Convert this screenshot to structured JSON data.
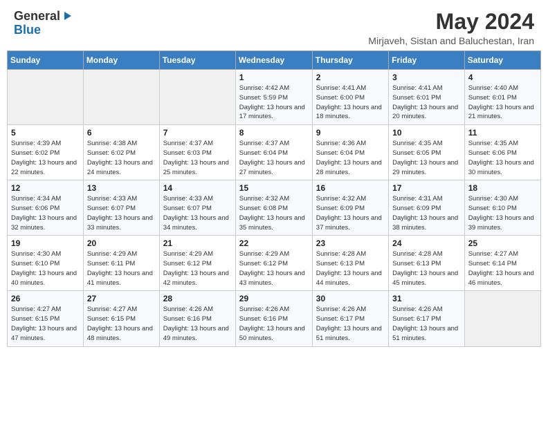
{
  "header": {
    "logo_general": "General",
    "logo_blue": "Blue",
    "month": "May 2024",
    "location": "Mirjaveh, Sistan and Baluchestan, Iran"
  },
  "weekdays": [
    "Sunday",
    "Monday",
    "Tuesday",
    "Wednesday",
    "Thursday",
    "Friday",
    "Saturday"
  ],
  "weeks": [
    [
      {
        "day": "",
        "sunrise": "",
        "sunset": "",
        "daylight": ""
      },
      {
        "day": "",
        "sunrise": "",
        "sunset": "",
        "daylight": ""
      },
      {
        "day": "",
        "sunrise": "",
        "sunset": "",
        "daylight": ""
      },
      {
        "day": "1",
        "sunrise": "Sunrise: 4:42 AM",
        "sunset": "Sunset: 5:59 PM",
        "daylight": "Daylight: 13 hours and 17 minutes."
      },
      {
        "day": "2",
        "sunrise": "Sunrise: 4:41 AM",
        "sunset": "Sunset: 6:00 PM",
        "daylight": "Daylight: 13 hours and 18 minutes."
      },
      {
        "day": "3",
        "sunrise": "Sunrise: 4:41 AM",
        "sunset": "Sunset: 6:01 PM",
        "daylight": "Daylight: 13 hours and 20 minutes."
      },
      {
        "day": "4",
        "sunrise": "Sunrise: 4:40 AM",
        "sunset": "Sunset: 6:01 PM",
        "daylight": "Daylight: 13 hours and 21 minutes."
      }
    ],
    [
      {
        "day": "5",
        "sunrise": "Sunrise: 4:39 AM",
        "sunset": "Sunset: 6:02 PM",
        "daylight": "Daylight: 13 hours and 22 minutes."
      },
      {
        "day": "6",
        "sunrise": "Sunrise: 4:38 AM",
        "sunset": "Sunset: 6:02 PM",
        "daylight": "Daylight: 13 hours and 24 minutes."
      },
      {
        "day": "7",
        "sunrise": "Sunrise: 4:37 AM",
        "sunset": "Sunset: 6:03 PM",
        "daylight": "Daylight: 13 hours and 25 minutes."
      },
      {
        "day": "8",
        "sunrise": "Sunrise: 4:37 AM",
        "sunset": "Sunset: 6:04 PM",
        "daylight": "Daylight: 13 hours and 27 minutes."
      },
      {
        "day": "9",
        "sunrise": "Sunrise: 4:36 AM",
        "sunset": "Sunset: 6:04 PM",
        "daylight": "Daylight: 13 hours and 28 minutes."
      },
      {
        "day": "10",
        "sunrise": "Sunrise: 4:35 AM",
        "sunset": "Sunset: 6:05 PM",
        "daylight": "Daylight: 13 hours and 29 minutes."
      },
      {
        "day": "11",
        "sunrise": "Sunrise: 4:35 AM",
        "sunset": "Sunset: 6:06 PM",
        "daylight": "Daylight: 13 hours and 30 minutes."
      }
    ],
    [
      {
        "day": "12",
        "sunrise": "Sunrise: 4:34 AM",
        "sunset": "Sunset: 6:06 PM",
        "daylight": "Daylight: 13 hours and 32 minutes."
      },
      {
        "day": "13",
        "sunrise": "Sunrise: 4:33 AM",
        "sunset": "Sunset: 6:07 PM",
        "daylight": "Daylight: 13 hours and 33 minutes."
      },
      {
        "day": "14",
        "sunrise": "Sunrise: 4:33 AM",
        "sunset": "Sunset: 6:07 PM",
        "daylight": "Daylight: 13 hours and 34 minutes."
      },
      {
        "day": "15",
        "sunrise": "Sunrise: 4:32 AM",
        "sunset": "Sunset: 6:08 PM",
        "daylight": "Daylight: 13 hours and 35 minutes."
      },
      {
        "day": "16",
        "sunrise": "Sunrise: 4:32 AM",
        "sunset": "Sunset: 6:09 PM",
        "daylight": "Daylight: 13 hours and 37 minutes."
      },
      {
        "day": "17",
        "sunrise": "Sunrise: 4:31 AM",
        "sunset": "Sunset: 6:09 PM",
        "daylight": "Daylight: 13 hours and 38 minutes."
      },
      {
        "day": "18",
        "sunrise": "Sunrise: 4:30 AM",
        "sunset": "Sunset: 6:10 PM",
        "daylight": "Daylight: 13 hours and 39 minutes."
      }
    ],
    [
      {
        "day": "19",
        "sunrise": "Sunrise: 4:30 AM",
        "sunset": "Sunset: 6:10 PM",
        "daylight": "Daylight: 13 hours and 40 minutes."
      },
      {
        "day": "20",
        "sunrise": "Sunrise: 4:29 AM",
        "sunset": "Sunset: 6:11 PM",
        "daylight": "Daylight: 13 hours and 41 minutes."
      },
      {
        "day": "21",
        "sunrise": "Sunrise: 4:29 AM",
        "sunset": "Sunset: 6:12 PM",
        "daylight": "Daylight: 13 hours and 42 minutes."
      },
      {
        "day": "22",
        "sunrise": "Sunrise: 4:29 AM",
        "sunset": "Sunset: 6:12 PM",
        "daylight": "Daylight: 13 hours and 43 minutes."
      },
      {
        "day": "23",
        "sunrise": "Sunrise: 4:28 AM",
        "sunset": "Sunset: 6:13 PM",
        "daylight": "Daylight: 13 hours and 44 minutes."
      },
      {
        "day": "24",
        "sunrise": "Sunrise: 4:28 AM",
        "sunset": "Sunset: 6:13 PM",
        "daylight": "Daylight: 13 hours and 45 minutes."
      },
      {
        "day": "25",
        "sunrise": "Sunrise: 4:27 AM",
        "sunset": "Sunset: 6:14 PM",
        "daylight": "Daylight: 13 hours and 46 minutes."
      }
    ],
    [
      {
        "day": "26",
        "sunrise": "Sunrise: 4:27 AM",
        "sunset": "Sunset: 6:15 PM",
        "daylight": "Daylight: 13 hours and 47 minutes."
      },
      {
        "day": "27",
        "sunrise": "Sunrise: 4:27 AM",
        "sunset": "Sunset: 6:15 PM",
        "daylight": "Daylight: 13 hours and 48 minutes."
      },
      {
        "day": "28",
        "sunrise": "Sunrise: 4:26 AM",
        "sunset": "Sunset: 6:16 PM",
        "daylight": "Daylight: 13 hours and 49 minutes."
      },
      {
        "day": "29",
        "sunrise": "Sunrise: 4:26 AM",
        "sunset": "Sunset: 6:16 PM",
        "daylight": "Daylight: 13 hours and 50 minutes."
      },
      {
        "day": "30",
        "sunrise": "Sunrise: 4:26 AM",
        "sunset": "Sunset: 6:17 PM",
        "daylight": "Daylight: 13 hours and 51 minutes."
      },
      {
        "day": "31",
        "sunrise": "Sunrise: 4:26 AM",
        "sunset": "Sunset: 6:17 PM",
        "daylight": "Daylight: 13 hours and 51 minutes."
      },
      {
        "day": "",
        "sunrise": "",
        "sunset": "",
        "daylight": ""
      }
    ]
  ]
}
